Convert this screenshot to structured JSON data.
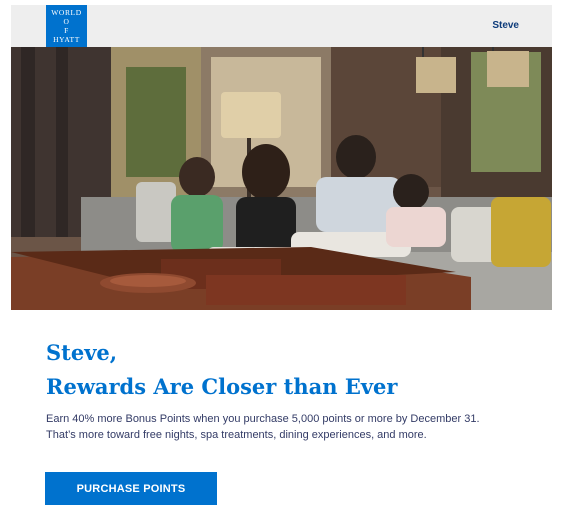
{
  "header": {
    "logo_lines": [
      "WORLD",
      "O",
      "F",
      "HYATT"
    ],
    "account_name": "Steve"
  },
  "hero": {
    "image_icon": "family-on-sofa-photo"
  },
  "main": {
    "greeting": "Steve,",
    "headline": "Rewards Are Closer than Ever",
    "body_line_1": "Earn 40% more Bonus Points when you purchase 5,000 points or more by December 31.",
    "body_line_2": "That’s more toward free nights, spa treatments, dining experiences, and more.",
    "cta_label": "PURCHASE POINTS"
  },
  "colors": {
    "brand_blue": "#0072ce",
    "header_bg": "#eeeeee",
    "account_text": "#0d3b7a",
    "body_text": "#333b66"
  }
}
